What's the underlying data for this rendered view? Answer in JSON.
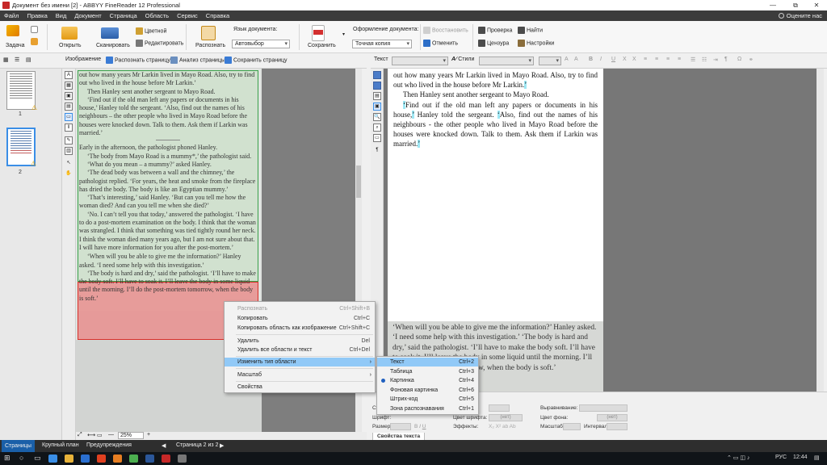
{
  "window": {
    "title": "Документ без имени [2] - ABBYY FineReader 12 Professional",
    "controls": [
      "—",
      "⧉",
      "✕"
    ],
    "restore_icon": "⧉",
    "close_icon": "✕"
  },
  "menu": {
    "items": [
      "Файл",
      "Правка",
      "Вид",
      "Документ",
      "Страница",
      "Область",
      "Сервис",
      "Справка"
    ],
    "rate": "Оцените нас"
  },
  "ribbon": {
    "task": "Задача",
    "open": "Открыть",
    "scan": "Сканировать",
    "color": "Цветной",
    "edit": "Редактировать",
    "recognize": "Распознать",
    "doc_lang_label": "Язык документа:",
    "doc_lang_value": "Автовыбор",
    "save": "Сохранить",
    "format_label": "Оформление документа:",
    "format_value": "Точная копия",
    "restore": "Восстановить",
    "cancel": "Отменить",
    "check": "Проверка",
    "find": "Найти",
    "censor": "Цензура",
    "settings": "Настройки"
  },
  "image_toolbar": {
    "label": "Изображение",
    "recognize_page": "Распознать страницу",
    "analyze_page": "Анализ страницы",
    "save_page": "Сохранить страницу"
  },
  "text_toolbar": {
    "label": "Текст",
    "styles": "Стили",
    "symbols": [
      "A",
      "A",
      "B",
      "I",
      "U",
      "X",
      "X",
      "¶",
      "Ω"
    ]
  },
  "thumbnails": [
    {
      "number": "1"
    },
    {
      "number": "2"
    }
  ],
  "scan_text": {
    "p1": "out how many years Mr Larkin lived in Mayo Road. Also, try to find out who lived in the house before Mr Larkin.’",
    "p2": "Then Hanley sent another sergeant to Mayo Road.",
    "p3": "‘Find out if the old man left any papers or documents in his house,’ Hanley told the sergeant. ‘Also, find out the names of his neighbours – the other people who lived in Mayo Road before the houses were knocked down. Talk to them. Ask them if Larkin was married.’",
    "p4": "Early in the afternoon, the pathologist phoned Hanley.",
    "p5": "‘The body from Mayo Road is a mummy*,’ the pathologist said.",
    "p6": "‘What do you mean – a mummy?’ asked Hanley.",
    "p7": "‘The dead body was between a wall and the chimney,’ the pathologist replied. ‘For years, the heat and smoke from the fireplace has dried the body. The body is like an Egyptian mummy.’",
    "p8": "‘That’s interesting,’ said Hanley. ‘But can you tell me how the woman died? And can you tell me when she died?’",
    "p9": "‘No. I can’t tell you that today,’ answered the pathologist. ‘I have to do a post-mortem examination on the body. I think that the woman was strangled. I think that something was tied tightly round her neck. I think the woman died many years ago, but I am not sure about that. I will have more information for you after the post-mortem.’",
    "p10": "‘When will you be able to give me the information?’ Hanley asked. ‘I need some help with this investigation.’",
    "p11": "‘The body is hard and dry,’ said the pathologist. ‘I’ll have to make the body soft. I’ll have to soak it. I’ll leave the body in some liquid until the morning. I’ll do the post-mortem tomorrow, when the body is soft.’"
  },
  "recognized_text": {
    "p1": "out how many years Mr Larkin lived in Mayo Road. Also, try to find out who lived in the house before Mr Larkin.",
    "p2": "Then Hanley sent another sergeant to Mayo Road.",
    "p3a": "Find out if the old man left any papers or documents in his house,",
    "p3b": " Hanley told the sergeant. ",
    "p3c": "Also, find out the names of his neighbours - the other people who lived in Mayo Road before the houses were knocked down. Talk to them. Ask them if Larkin was married.",
    "image_text": "‘When will you be able to give me the information?’ Hanley asked. ‘I need some help with this investigation.’ ‘The body is hard and dry,’ said the pathologist. ‘I’ll have to make the body soft. I’ll have to soak it. I’ll leave the body in some liquid until the morning. I’ll do the post-mortem tomorrow, when the body is soft.’"
  },
  "context_menu": {
    "items": [
      {
        "label": "Распознать",
        "shortcut": "Ctrl+Shift+B",
        "disabled": true
      },
      {
        "label": "Копировать",
        "shortcut": "Ctrl+C"
      },
      {
        "label": "Копировать область как изображение",
        "shortcut": "Ctrl+Shift+C"
      },
      {
        "label": "Удалить",
        "shortcut": "Del"
      },
      {
        "label": "Удалить все области и текст",
        "shortcut": "Ctrl+Del"
      },
      {
        "label": "Изменить тип области",
        "shortcut": ""
      },
      {
        "label": "Масштаб",
        "shortcut": ""
      },
      {
        "label": "Свойства",
        "shortcut": ""
      }
    ]
  },
  "submenu": {
    "items": [
      {
        "label": "Текст",
        "shortcut": "Ctrl+2"
      },
      {
        "label": "Таблица",
        "shortcut": "Ctrl+3"
      },
      {
        "label": "Картинка",
        "shortcut": "Ctrl+4"
      },
      {
        "label": "Фоновая картинка",
        "shortcut": "Ctrl+6"
      },
      {
        "label": "Штрих-код",
        "shortcut": "Ctrl+5"
      },
      {
        "label": "Зона распознавания",
        "shortcut": "Ctrl+1"
      }
    ]
  },
  "properties": {
    "font_label": "Шрифт:",
    "font_color": "Цвет шрифта:",
    "size": "Размер:",
    "effects": "Эффекты:",
    "alignment": "Выравнивание:",
    "bg_color": "Цвет фона:",
    "scale": "Масштаб:",
    "interval": "Интервал:",
    "none1": "(нет)",
    "none2": "(нет)",
    "st": "Ст",
    "tab": "Свойства текста"
  },
  "image_bottom": {
    "zoom": "25%"
  },
  "status": {
    "pages": "Страницы",
    "closeup": "Крупный план",
    "warnings": "Предупреждения",
    "page_of": "Страница 2 из 2"
  },
  "taskbar": {
    "lang": "РУС",
    "time": "12:44"
  }
}
